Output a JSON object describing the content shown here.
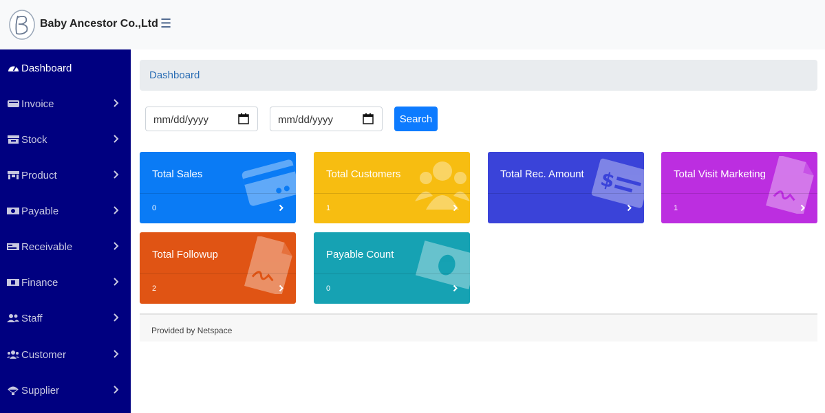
{
  "header": {
    "company_name": "Baby Ancestor Co.,Ltd"
  },
  "sidebar": {
    "items": [
      {
        "label": "Dashboard",
        "icon": "tachometer-icon",
        "active": true
      },
      {
        "label": "Invoice",
        "icon": "invoice-icon"
      },
      {
        "label": "Stock",
        "icon": "warehouse-icon"
      },
      {
        "label": "Product",
        "icon": "store-icon"
      },
      {
        "label": "Payable",
        "icon": "money-bill-icon"
      },
      {
        "label": "Receivable",
        "icon": "receipt-icon"
      },
      {
        "label": "Finance",
        "icon": "money-icon"
      },
      {
        "label": "Staff",
        "icon": "user-friends-icon"
      },
      {
        "label": "Customer",
        "icon": "users-icon"
      },
      {
        "label": "Supplier",
        "icon": "parachute-icon"
      }
    ]
  },
  "breadcrumb": {
    "label": "Dashboard"
  },
  "filter": {
    "start_date_placeholder": "mm/dd/yyyy",
    "end_date_placeholder": "mm/dd/yyyy",
    "search_label": "Search"
  },
  "cards": [
    {
      "title": "Total Sales",
      "value": "0",
      "color": "#0a7bf5",
      "icon": "credit-card-icon"
    },
    {
      "title": "Total Customers",
      "value": "1",
      "color": "#f7bd11",
      "icon": "users-icon"
    },
    {
      "title": "Total Rec. Amount",
      "value": "",
      "color": "#3a43d9",
      "icon": "money-check-icon"
    },
    {
      "title": "Total Visit Marketing",
      "value": "1",
      "color": "#bc2ee0",
      "icon": "file-signature-icon"
    },
    {
      "title": "Total Followup",
      "value": "2",
      "color": "#e05414",
      "icon": "file-signature-icon"
    },
    {
      "title": "Payable Count",
      "value": "0",
      "color": "#16a2b3",
      "icon": "money-bill-icon"
    }
  ],
  "footer": {
    "text": "Provided by Netspace"
  }
}
